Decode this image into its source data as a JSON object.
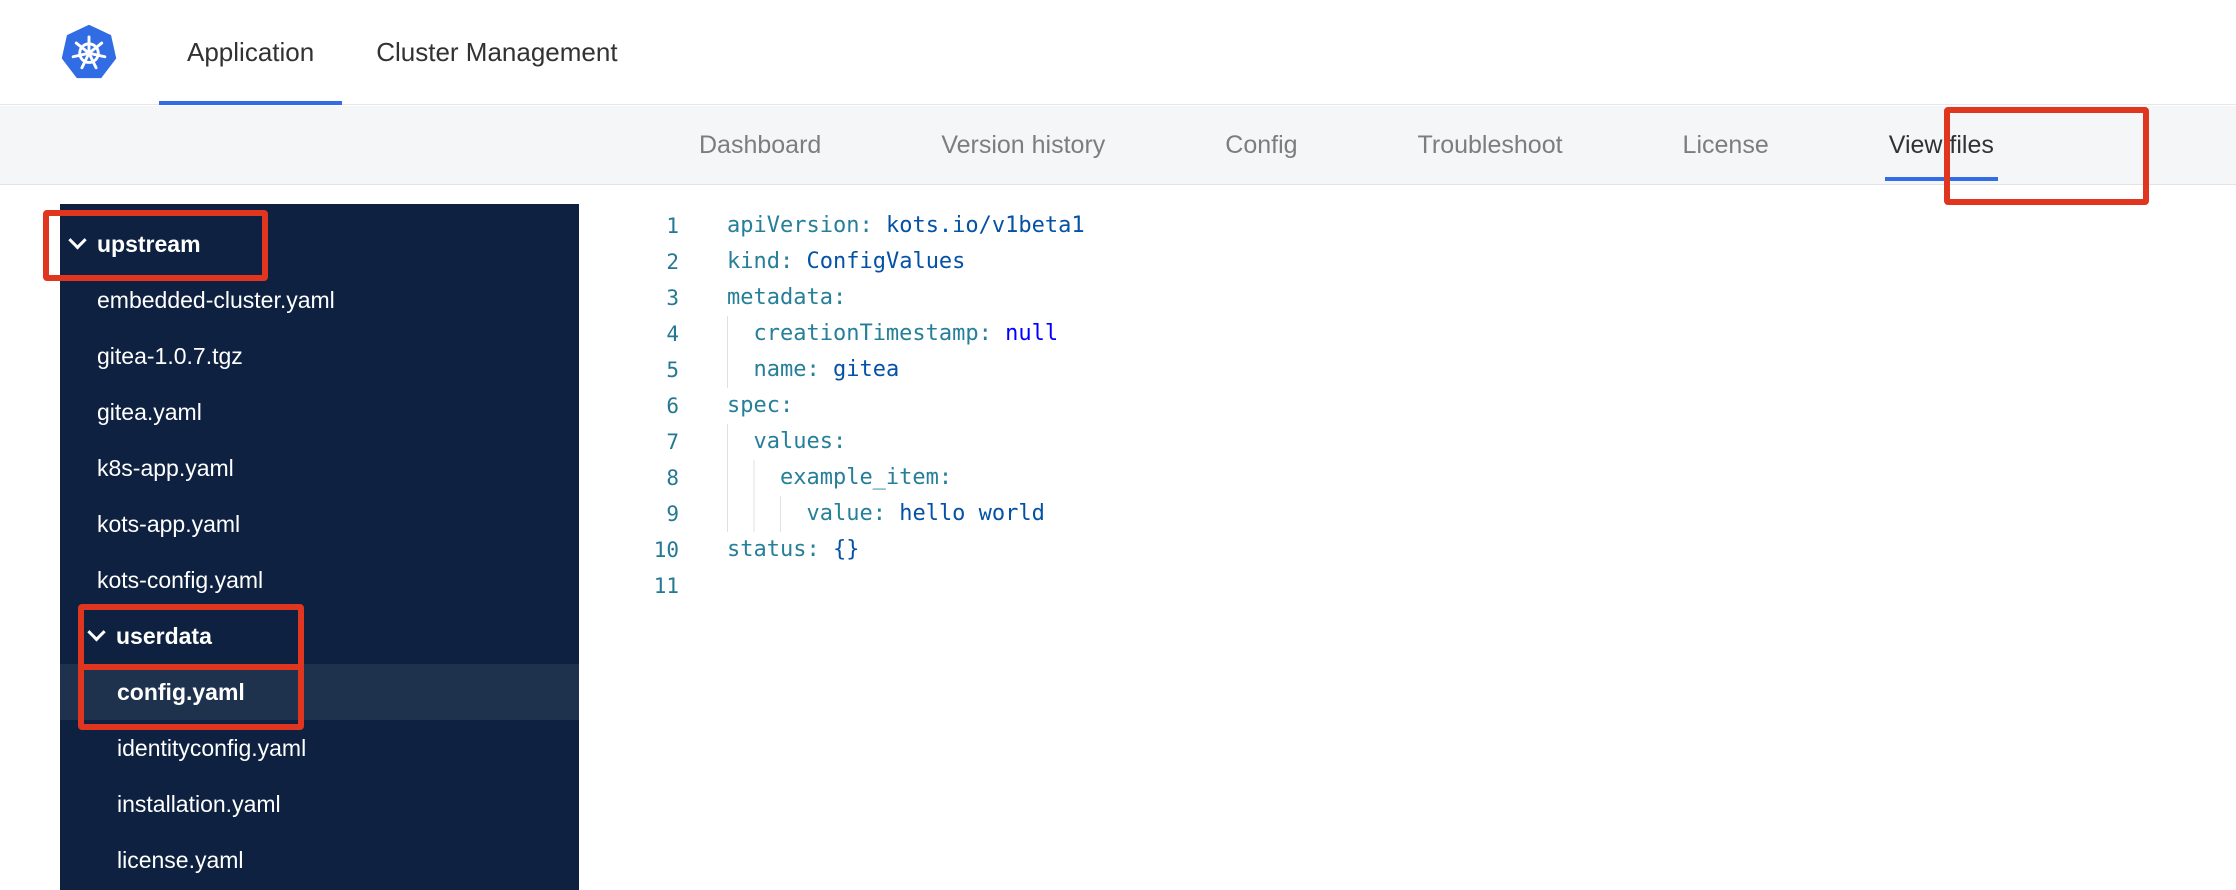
{
  "header": {
    "logo": "kubernetes-logo",
    "tabs": [
      {
        "label": "Application",
        "active": true
      },
      {
        "label": "Cluster Management",
        "active": false
      }
    ]
  },
  "subnav": {
    "items": [
      {
        "label": "Dashboard",
        "active": false
      },
      {
        "label": "Version history",
        "active": false
      },
      {
        "label": "Config",
        "active": false
      },
      {
        "label": "Troubleshoot",
        "active": false
      },
      {
        "label": "License",
        "active": false
      },
      {
        "label": "View files",
        "active": true
      }
    ]
  },
  "sidebar": {
    "items": [
      {
        "label": "upstream",
        "kind": "folder",
        "level": 0,
        "expanded": true,
        "selected": false
      },
      {
        "label": "embedded-cluster.yaml",
        "kind": "file",
        "level": 1,
        "selected": false
      },
      {
        "label": "gitea-1.0.7.tgz",
        "kind": "file",
        "level": 1,
        "selected": false
      },
      {
        "label": "gitea.yaml",
        "kind": "file",
        "level": 1,
        "selected": false
      },
      {
        "label": "k8s-app.yaml",
        "kind": "file",
        "level": 1,
        "selected": false
      },
      {
        "label": "kots-app.yaml",
        "kind": "file",
        "level": 1,
        "selected": false
      },
      {
        "label": "kots-config.yaml",
        "kind": "file",
        "level": 1,
        "selected": false
      },
      {
        "label": "userdata",
        "kind": "folder",
        "level": 1,
        "expanded": true,
        "selected": false
      },
      {
        "label": "config.yaml",
        "kind": "file",
        "level": 2,
        "selected": true
      },
      {
        "label": "identityconfig.yaml",
        "kind": "file",
        "level": 2,
        "selected": false
      },
      {
        "label": "installation.yaml",
        "kind": "file",
        "level": 2,
        "selected": false
      },
      {
        "label": "license.yaml",
        "kind": "file",
        "level": 2,
        "selected": false
      }
    ]
  },
  "editor": {
    "lines": [
      {
        "number": "1",
        "indent": 0,
        "tokens": [
          [
            "apiVersion:",
            "key"
          ],
          [
            " ",
            "plain"
          ],
          [
            "kots.io/v1beta1",
            "val"
          ]
        ]
      },
      {
        "number": "2",
        "indent": 0,
        "tokens": [
          [
            "kind:",
            "key"
          ],
          [
            " ",
            "plain"
          ],
          [
            "ConfigValues",
            "val"
          ]
        ]
      },
      {
        "number": "3",
        "indent": 0,
        "tokens": [
          [
            "metadata:",
            "key"
          ]
        ]
      },
      {
        "number": "4",
        "indent": 2,
        "tokens": [
          [
            "creationTimestamp:",
            "key"
          ],
          [
            " ",
            "plain"
          ],
          [
            "null",
            "kw"
          ]
        ]
      },
      {
        "number": "5",
        "indent": 2,
        "tokens": [
          [
            "name:",
            "key"
          ],
          [
            " ",
            "plain"
          ],
          [
            "gitea",
            "val"
          ]
        ]
      },
      {
        "number": "6",
        "indent": 0,
        "tokens": [
          [
            "spec:",
            "key"
          ]
        ]
      },
      {
        "number": "7",
        "indent": 2,
        "tokens": [
          [
            "values:",
            "key"
          ]
        ]
      },
      {
        "number": "8",
        "indent": 4,
        "tokens": [
          [
            "example_item:",
            "key"
          ]
        ]
      },
      {
        "number": "9",
        "indent": 6,
        "tokens": [
          [
            "value:",
            "key"
          ],
          [
            " ",
            "plain"
          ],
          [
            "hello world",
            "val"
          ]
        ]
      },
      {
        "number": "10",
        "indent": 0,
        "tokens": [
          [
            "status:",
            "key"
          ],
          [
            " ",
            "plain"
          ],
          [
            "{}",
            "val"
          ]
        ]
      },
      {
        "number": "11",
        "indent": 0,
        "tokens": []
      }
    ]
  },
  "annotations": {
    "highlighted_elements": [
      "view-files-tab",
      "upstream-folder",
      "userdata-folder",
      "config-yaml-file"
    ]
  },
  "colors": {
    "accent_blue": "#326de6",
    "kubernetes_blue": "#326ce5",
    "annotation_red": "#e0351f",
    "sidebar_bg": "#0e2140",
    "sidebar_selected_bg": "#1e314d",
    "code_key": "#267f99",
    "code_value": "#0451a5",
    "code_keyword": "#0000ff",
    "line_number": "#237893"
  }
}
